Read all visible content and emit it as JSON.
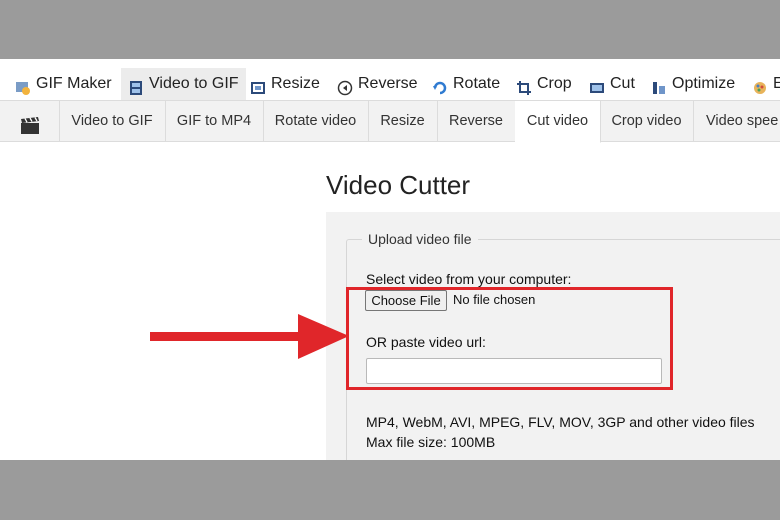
{
  "top_nav": [
    {
      "label": "GIF Maker",
      "icon": "gif-maker-icon"
    },
    {
      "label": "Video to GIF",
      "icon": "film-icon",
      "active": true
    },
    {
      "label": "Resize",
      "icon": "resize-icon"
    },
    {
      "label": "Reverse",
      "icon": "reverse-icon"
    },
    {
      "label": "Rotate",
      "icon": "rotate-icon"
    },
    {
      "label": "Crop",
      "icon": "crop-icon"
    },
    {
      "label": "Cut",
      "icon": "cut-icon"
    },
    {
      "label": "Optimize",
      "icon": "optimize-icon"
    },
    {
      "label": "E",
      "icon": "effects-icon"
    }
  ],
  "sub_nav": [
    {
      "label": "Video to GIF"
    },
    {
      "label": "GIF to MP4"
    },
    {
      "label": "Rotate video"
    },
    {
      "label": "Resize"
    },
    {
      "label": "Reverse"
    },
    {
      "label": "Cut video",
      "active": true
    },
    {
      "label": "Crop video"
    },
    {
      "label": "Video spee"
    }
  ],
  "page": {
    "title": "Video Cutter",
    "legend": "Upload video file",
    "select_label": "Select video from your computer:",
    "choose_file": "Choose File",
    "no_file": "No file chosen",
    "url_label": "OR paste video url:",
    "url_value": "",
    "formats": "MP4, WebM, AVI, MPEG, FLV, MOV, 3GP and other video files",
    "max_size": "Max file size: 100MB"
  },
  "colors": {
    "highlight": "#e0262a",
    "arrow": "#e0262a",
    "panel": "#f2f2f2"
  }
}
